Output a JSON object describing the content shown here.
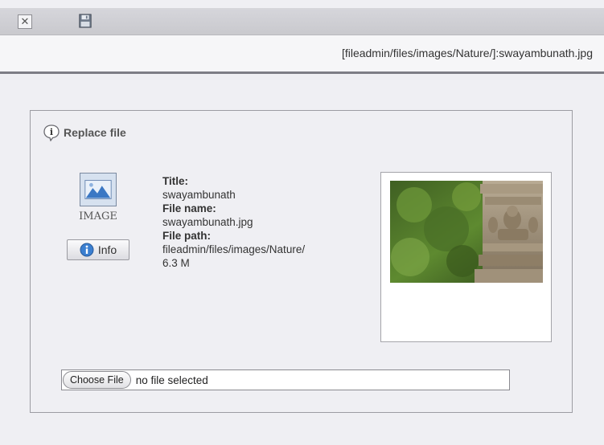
{
  "toolbar": {
    "close_icon": "close-icon",
    "save_icon": "save-icon"
  },
  "path": {
    "text": "[fileadmin/files/images/Nature/]:swayambunath.jpg"
  },
  "panel": {
    "title": "Replace file",
    "file_type_label": "IMAGE",
    "info_button_label": "Info",
    "fields": [
      {
        "label": "Title:",
        "value": "swayambunath"
      },
      {
        "label": "File name:",
        "value": "swayambunath.jpg"
      },
      {
        "label": "File path:",
        "value": "fileadmin/files/images/Nature/"
      }
    ],
    "file_size": "6.3 M",
    "thumbnail_alt": "swayambunath"
  },
  "upload": {
    "button_label": "Choose File",
    "status_text": "no file selected"
  },
  "colors": {
    "background": "#efeff3",
    "panel_border": "#9c9ca2",
    "accent_blue": "#3b78c4"
  }
}
